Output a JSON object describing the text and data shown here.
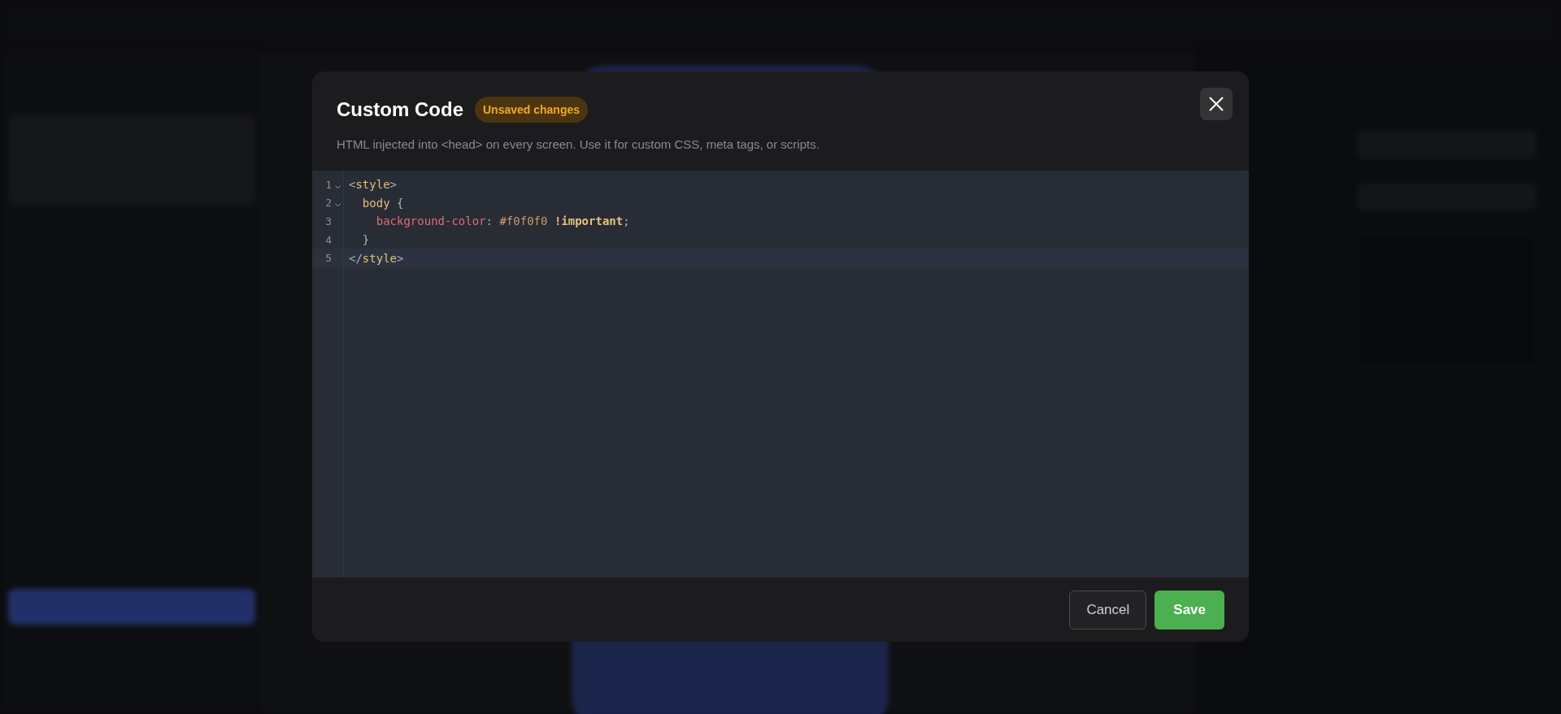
{
  "dialog": {
    "title": "Custom Code",
    "badge": "Unsaved changes",
    "description": "HTML injected into <head> on every screen. Use it for custom CSS, meta tags, or scripts.",
    "editor": {
      "lines": [
        {
          "number": "1",
          "fold": true,
          "active": false,
          "tokens": [
            {
              "kind": "punct",
              "text": "<"
            },
            {
              "kind": "tag",
              "text": "style"
            },
            {
              "kind": "punct",
              "text": ">"
            }
          ]
        },
        {
          "number": "2",
          "fold": true,
          "active": false,
          "tokens": [
            {
              "kind": "tag",
              "text": "  body"
            },
            {
              "kind": "punct",
              "text": " {"
            }
          ]
        },
        {
          "number": "3",
          "fold": false,
          "active": false,
          "tokens": [
            {
              "kind": "prop",
              "text": "    background-color"
            },
            {
              "kind": "punct",
              "text": ": "
            },
            {
              "kind": "value",
              "text": "#f0f0f0"
            },
            {
              "kind": "keyword",
              "text": " !important"
            },
            {
              "kind": "punct",
              "text": ";"
            }
          ]
        },
        {
          "number": "4",
          "fold": false,
          "active": false,
          "tokens": [
            {
              "kind": "punct",
              "text": "  }"
            }
          ]
        },
        {
          "number": "5",
          "fold": false,
          "active": true,
          "tokens": [
            {
              "kind": "punct",
              "text": "</"
            },
            {
              "kind": "tag",
              "text": "style"
            },
            {
              "kind": "punct",
              "text": ">"
            }
          ]
        }
      ]
    },
    "buttons": [
      {
        "kind": "secondary",
        "label": "Cancel"
      },
      {
        "kind": "primary",
        "label": "Save"
      }
    ]
  }
}
